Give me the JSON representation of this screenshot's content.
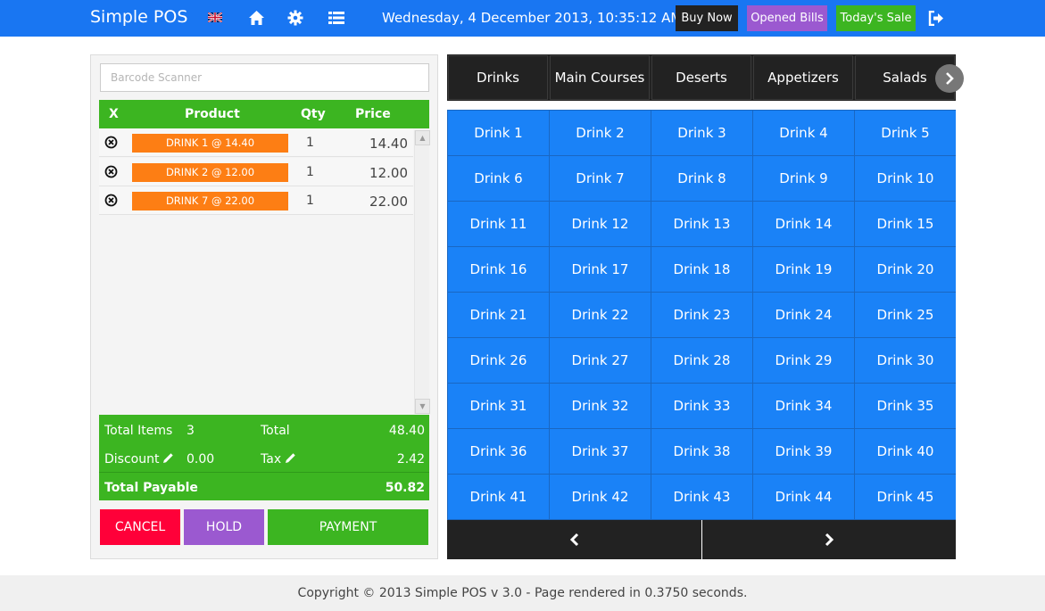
{
  "navbar": {
    "brand": "Simple POS",
    "icons": [
      "uk-flag-icon",
      "home-icon",
      "gear-icon",
      "list-icon",
      "logout-icon"
    ],
    "datetime": "Wednesday, 4 December 2013, 10:35:12 AM",
    "buttons": {
      "buy_now": "Buy Now",
      "opened_bills": "Opened Bills",
      "todays_sale": "Today's Sale"
    }
  },
  "barcode": {
    "placeholder": "Barcode Scanner"
  },
  "order_table": {
    "headers": {
      "remove": "X",
      "product": "Product",
      "qty": "Qty",
      "price": "Price"
    },
    "rows": [
      {
        "product": "DRINK 1 @ 14.40",
        "qty": "1",
        "price": "14.40"
      },
      {
        "product": "DRINK 2 @ 12.00",
        "qty": "1",
        "price": "12.00"
      },
      {
        "product": "DRINK 7 @ 22.00",
        "qty": "1",
        "price": "22.00"
      }
    ]
  },
  "totals": {
    "total_items_label": "Total Items",
    "total_items": "3",
    "total_label": "Total",
    "total": "48.40",
    "discount_label": "Discount",
    "discount": "0.00",
    "tax_label": "Tax",
    "tax": "2.42",
    "payable_label": "Total Payable",
    "payable": "50.82"
  },
  "actions": {
    "cancel": "CANCEL",
    "hold": "HOLD",
    "payment": "PAYMENT"
  },
  "categories": [
    "Drinks",
    "Main Courses",
    "Deserts",
    "Appetizers",
    "Salads"
  ],
  "products": [
    "Drink 1",
    "Drink 2",
    "Drink 3",
    "Drink 4",
    "Drink 5",
    "Drink 6",
    "Drink 7",
    "Drink 8",
    "Drink 9",
    "Drink 10",
    "Drink 11",
    "Drink 12",
    "Drink 13",
    "Drink 14",
    "Drink 15",
    "Drink 16",
    "Drink 17",
    "Drink 18",
    "Drink 19",
    "Drink 20",
    "Drink 21",
    "Drink 22",
    "Drink 23",
    "Drink 24",
    "Drink 25",
    "Drink 26",
    "Drink 27",
    "Drink 28",
    "Drink 29",
    "Drink 30",
    "Drink 31",
    "Drink 32",
    "Drink 33",
    "Drink 34",
    "Drink 35",
    "Drink 36",
    "Drink 37",
    "Drink 38",
    "Drink 39",
    "Drink 40",
    "Drink 41",
    "Drink 42",
    "Drink 43",
    "Drink 44",
    "Drink 45"
  ],
  "footer": "Copyright © 2013 Simple POS v 3.0 - Page rendered in 0.3750 seconds.",
  "colors": {
    "navbar": "#1976f2",
    "green": "#3cb521",
    "orange": "#fd7e14",
    "purple": "#9b59d0",
    "red": "#ff0039",
    "tile_blue": "#1a82f7",
    "dark": "#222222"
  }
}
